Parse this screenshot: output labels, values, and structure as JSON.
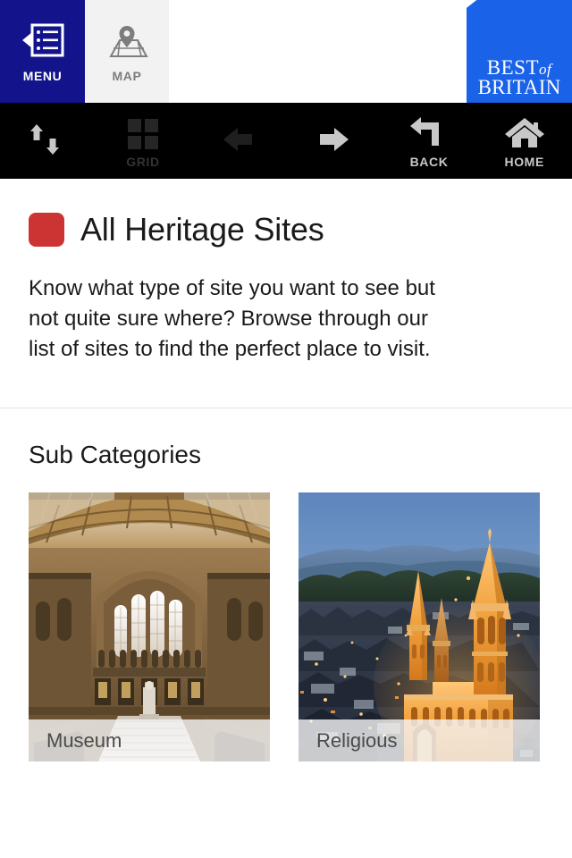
{
  "header": {
    "menu": {
      "label": "MENU",
      "icon": "menu-list-icon",
      "bg": "#13138c"
    },
    "map": {
      "label": "MAP",
      "icon": "map-pin-icon",
      "bg": "#f2f2f2"
    },
    "logo": {
      "line1": "BEST",
      "of": "of",
      "line2": "BRITAIN",
      "bg": "#1a62e8",
      "stripe_red": "#e8241f"
    }
  },
  "toolbar": {
    "items": [
      {
        "name": "sort-updown",
        "label": "",
        "icon": "up-down-arrows-icon",
        "enabled": true
      },
      {
        "name": "grid",
        "label": "GRID",
        "icon": "grid-icon",
        "enabled": false
      },
      {
        "name": "previous",
        "label": "",
        "icon": "arrow-left-icon",
        "enabled": false
      },
      {
        "name": "next",
        "label": "",
        "icon": "arrow-right-icon",
        "enabled": true
      },
      {
        "name": "back",
        "label": "BACK",
        "icon": "back-curved-arrow-icon",
        "enabled": true
      },
      {
        "name": "home",
        "label": "HOME",
        "icon": "home-house-icon",
        "enabled": true
      }
    ]
  },
  "page": {
    "badge_color": "#cc3333",
    "title": "All Heritage Sites",
    "description": "Know what type of site you want to see but not quite sure where? Browse through our list of sites to find the perfect place to visit.",
    "section_heading": "Sub Categories"
  },
  "cards": [
    {
      "label": "Museum",
      "image": "museum-great-hall-photo"
    },
    {
      "label": "Religious",
      "image": "cathedral-at-dusk-photo"
    }
  ]
}
